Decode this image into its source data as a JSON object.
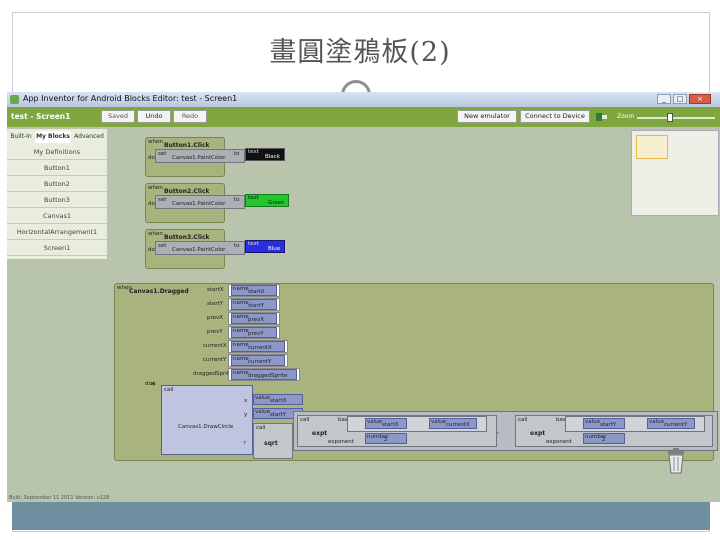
{
  "slide": {
    "title": "畫圓塗鴉板(2)"
  },
  "window": {
    "title": "App Inventor for Android Blocks Editor: test - Screen1",
    "controls": {
      "minimize": "_",
      "maximize": "□",
      "close": "×"
    }
  },
  "toolbar": {
    "screen_label": "test - Screen1",
    "saved": "Saved",
    "undo": "Undo",
    "redo": "Redo",
    "new_emulator": "New emulator",
    "connect_device": "Connect to Device",
    "zoom_label": "Zoom"
  },
  "sidebar": {
    "tabs": [
      "Built-In",
      "My Blocks",
      "Advanced"
    ],
    "items": [
      "My Definitions",
      "Button1",
      "Button2",
      "Button3",
      "Canvas1",
      "HorizontalArrangement1",
      "Screen1"
    ]
  },
  "blocks": {
    "when": "when",
    "do": "do",
    "set": "set",
    "to": "to",
    "text": "text",
    "value": "value",
    "name": "name",
    "call": "call",
    "base": "base",
    "exponent": "exponent",
    "number": "number",
    "expt": "expt",
    "sqrt": "sqrt",
    "plus": "+",
    "minus": "-",
    "times": "×",
    "button_handlers": [
      {
        "event": "Button1.Click",
        "property": "Canvas1.PaintColor",
        "color_name": "Black",
        "color": "#111111"
      },
      {
        "event": "Button2.Click",
        "property": "Canvas1.PaintColor",
        "color_name": "Green",
        "color": "#22c92a"
      },
      {
        "event": "Button3.Click",
        "property": "Canvas1.PaintColor",
        "color_name": "Blue",
        "color": "#2a2ee0"
      }
    ],
    "dragged": {
      "event": "Canvas1.Dragged",
      "params": [
        {
          "arg": "startX",
          "value": "startX"
        },
        {
          "arg": "startY",
          "value": "startY"
        },
        {
          "arg": "prevX",
          "value": "prevX"
        },
        {
          "arg": "prevY",
          "value": "prevY"
        },
        {
          "arg": "currentX",
          "value": "currentX"
        },
        {
          "arg": "currentY",
          "value": "currentY"
        },
        {
          "arg": "draggedSprite",
          "value": "draggedSprite"
        }
      ],
      "draw_call": "Canvas1.DrawCircle",
      "x_label": "x",
      "y_label": "y",
      "r_label": "r",
      "x_value": "startX",
      "y_value": "startY",
      "expt1_left": "startX",
      "expt1_right": "currentX",
      "expt1_exp": "2",
      "expt2_left": "startY",
      "expt2_right": "currentY",
      "expt2_exp": "2"
    }
  },
  "status": "Built: September 11 2011 Version: v128",
  "colors": {
    "toolbar": "#7fa63f",
    "workspace": "#b9c4ad",
    "event_block": "#a8b37d",
    "value_block": "#8c98c8"
  }
}
